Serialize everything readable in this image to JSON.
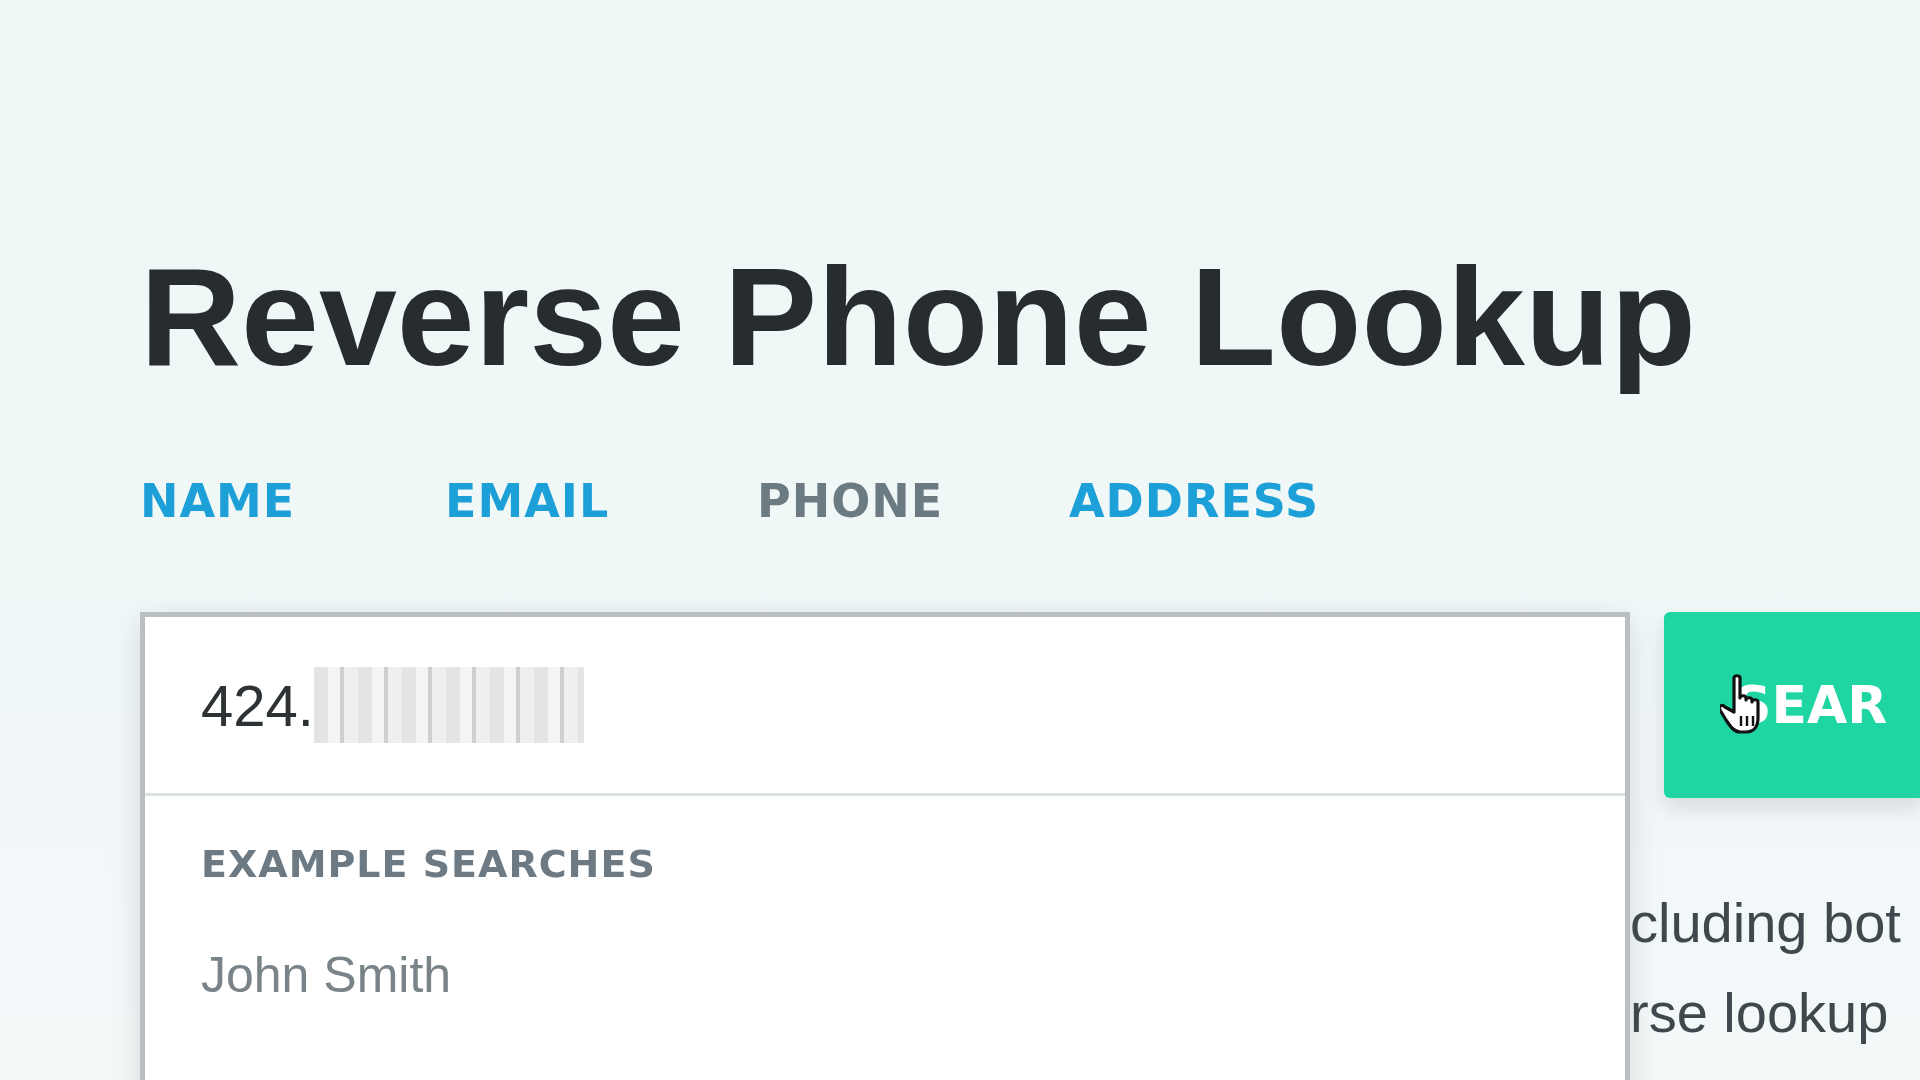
{
  "title": "Reverse Phone Lookup",
  "tabs": [
    {
      "label": "NAME",
      "selected": false
    },
    {
      "label": "EMAIL",
      "selected": false
    },
    {
      "label": "PHONE",
      "selected": true
    },
    {
      "label": "ADDRESS",
      "selected": false
    }
  ],
  "search": {
    "value": "424."
  },
  "dropdown": {
    "heading": "EXAMPLE SEARCHES",
    "items": [
      "John Smith"
    ]
  },
  "button": {
    "label": "SEAR"
  },
  "description": {
    "lines": [
      "cluding bot",
      "rse lookup"
    ]
  }
}
